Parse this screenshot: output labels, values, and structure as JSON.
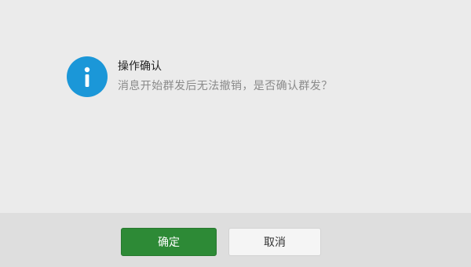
{
  "dialog": {
    "icon": "info-icon",
    "title": "操作确认",
    "message": "消息开始群发后无法撤销，是否确认群发？"
  },
  "buttons": {
    "confirm_label": "确定",
    "cancel_label": "取消"
  },
  "colors": {
    "icon_bg": "#1b97d8",
    "confirm_bg": "#2d8a36",
    "cancel_bg": "#f5f5f5",
    "body_bg": "#ebebeb",
    "footer_bg": "#dedede"
  }
}
